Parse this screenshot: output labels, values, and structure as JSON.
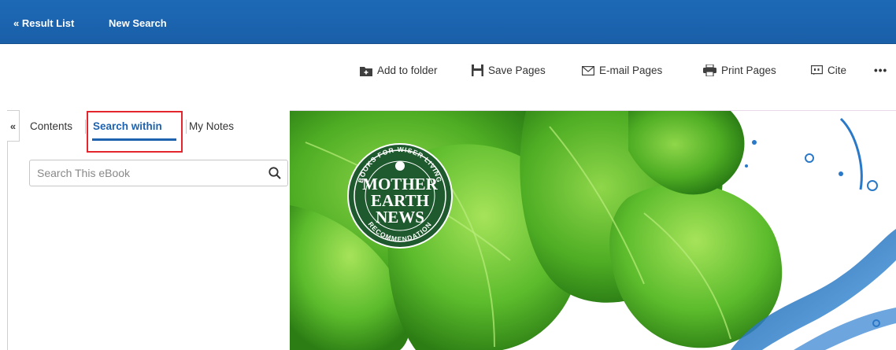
{
  "topbar": {
    "result_list": "« Result List",
    "new_search": "New Search"
  },
  "toolbar": {
    "add_to_folder": "Add to folder",
    "save_pages": "Save Pages",
    "email_pages": "E-mail Pages",
    "print_pages": "Print Pages",
    "cite": "Cite",
    "more": "•••"
  },
  "sidebar": {
    "collapse": "«",
    "tabs": [
      "Contents",
      "Search within",
      "My Notes"
    ],
    "active_tab": "Search within",
    "search_placeholder": "Search This eBook"
  },
  "book_cover": {
    "badge_top": "BOOKS FOR WISER LIVING",
    "badge_bottom": "RECOMMENDATION",
    "badge_lines": [
      "MOTHER",
      "EARTH",
      "NEWS"
    ]
  },
  "colors": {
    "topbar": "#1d69b6",
    "accent": "#1e63b0",
    "highlight": "#e3262e"
  }
}
